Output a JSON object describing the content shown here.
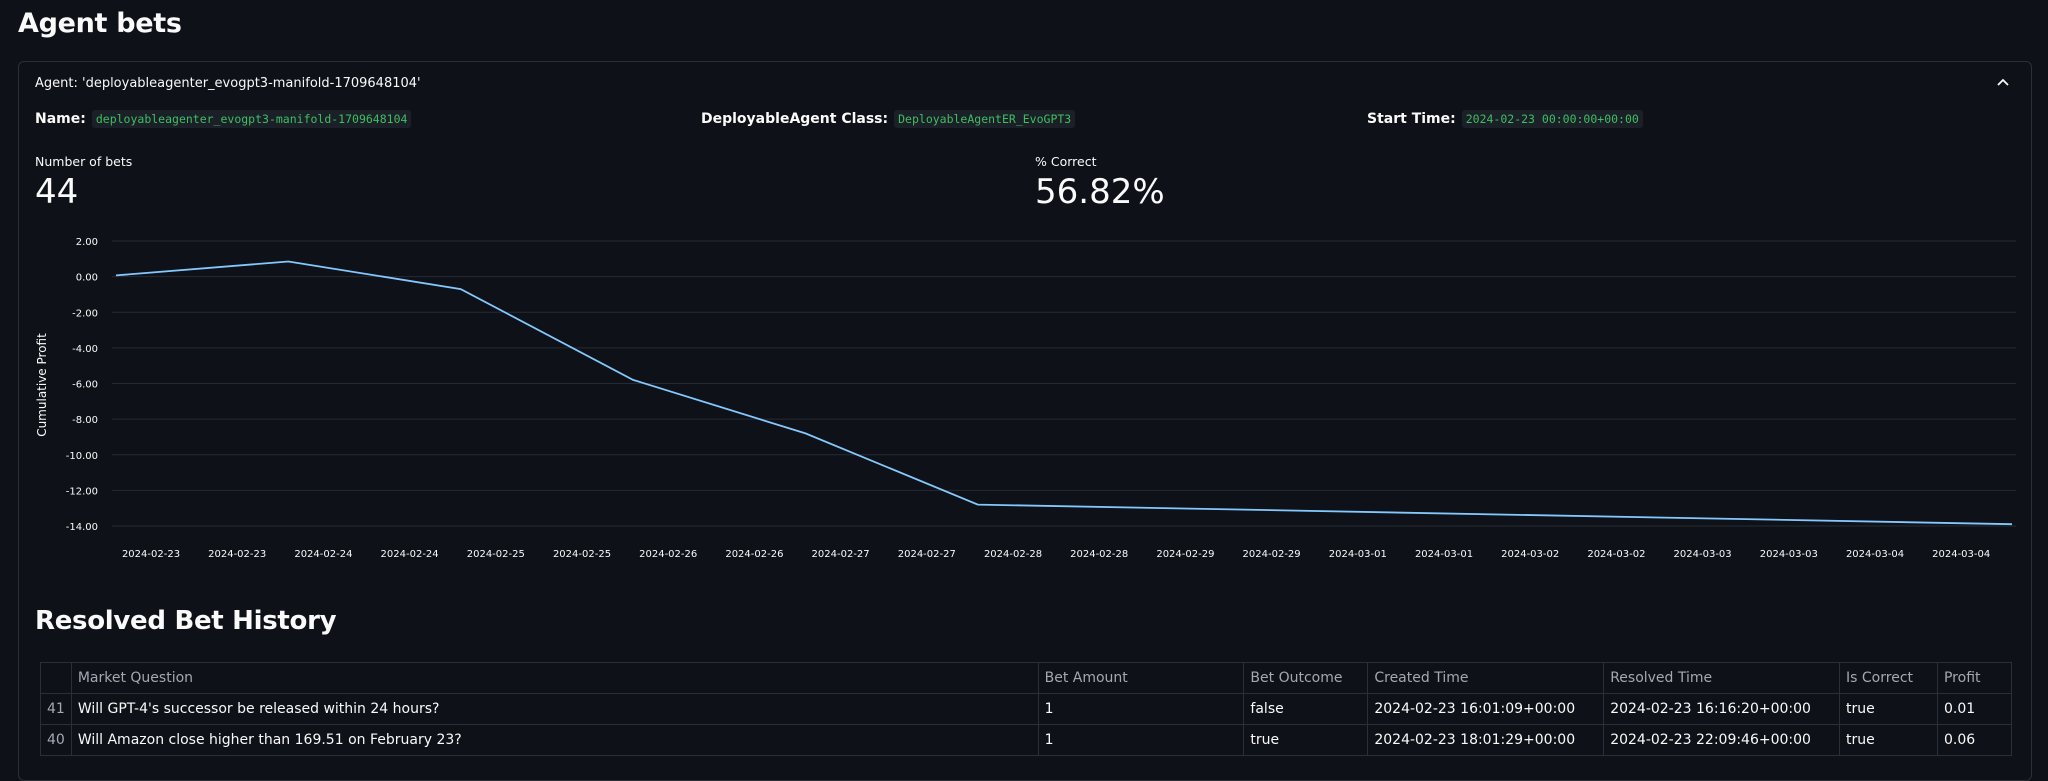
{
  "page": {
    "title": "Agent bets"
  },
  "expander": {
    "header": "Agent: 'deployableagenter_evogpt3-manifold-1709648104'",
    "name_label": "Name:",
    "name_value": "deployableagenter_evogpt3-manifold-1709648104",
    "class_label": "DeployableAgent Class:",
    "class_value": "DeployableAgentER_EvoGPT3",
    "start_label": "Start Time:",
    "start_value": "2024-02-23 00:00:00+00:00"
  },
  "metrics": {
    "bets_label": "Number of bets",
    "bets_value": "44",
    "correct_label": "% Correct",
    "correct_value": "56.82%"
  },
  "chart_data": {
    "type": "line",
    "ylabel": "Cumulative Profit",
    "xlabel": "",
    "ylim": [
      -14,
      2
    ],
    "y_ticks": [
      "2.00",
      "0.00",
      "-2.00",
      "-4.00",
      "-6.00",
      "-8.00",
      "-10.00",
      "-12.00",
      "-14.00"
    ],
    "x_ticks": [
      "2024-02-23",
      "2024-02-23",
      "2024-02-24",
      "2024-02-24",
      "2024-02-25",
      "2024-02-25",
      "2024-02-26",
      "2024-02-26",
      "2024-02-27",
      "2024-02-27",
      "2024-02-28",
      "2024-02-28",
      "2024-02-29",
      "2024-02-29",
      "2024-03-01",
      "2024-03-01",
      "2024-03-02",
      "2024-03-02",
      "2024-03-03",
      "2024-03-03",
      "2024-03-04",
      "2024-03-04"
    ],
    "grid": true,
    "line_color": "#83c9ff",
    "points": [
      {
        "x": "2024-02-23 00:00",
        "y": 0.07
      },
      {
        "x": "2024-02-24 00:00",
        "y": 0.85
      },
      {
        "x": "2024-02-25 00:00",
        "y": -0.7
      },
      {
        "x": "2024-02-26 00:00",
        "y": -5.8
      },
      {
        "x": "2024-02-27 00:00",
        "y": -8.8
      },
      {
        "x": "2024-02-28 00:00",
        "y": -12.8
      },
      {
        "x": "2024-03-05 00:00",
        "y": -13.9
      }
    ]
  },
  "history": {
    "title": "Resolved Bet History",
    "columns": [
      "",
      "Market Question",
      "Bet Amount",
      "Bet Outcome",
      "Created Time",
      "Resolved Time",
      "Is Correct",
      "Profit"
    ],
    "rows": [
      [
        "41",
        "Will GPT-4's successor be released within 24 hours?",
        "1",
        "false",
        "2024-02-23 16:01:09+00:00",
        "2024-02-23 16:16:20+00:00",
        "true",
        "0.01"
      ],
      [
        "40",
        "Will Amazon close higher than 169.51 on February 23?",
        "1",
        "true",
        "2024-02-23 18:01:29+00:00",
        "2024-02-23 22:09:46+00:00",
        "true",
        "0.06"
      ]
    ]
  },
  "icons": {
    "collapse": "chevron-up-icon"
  }
}
